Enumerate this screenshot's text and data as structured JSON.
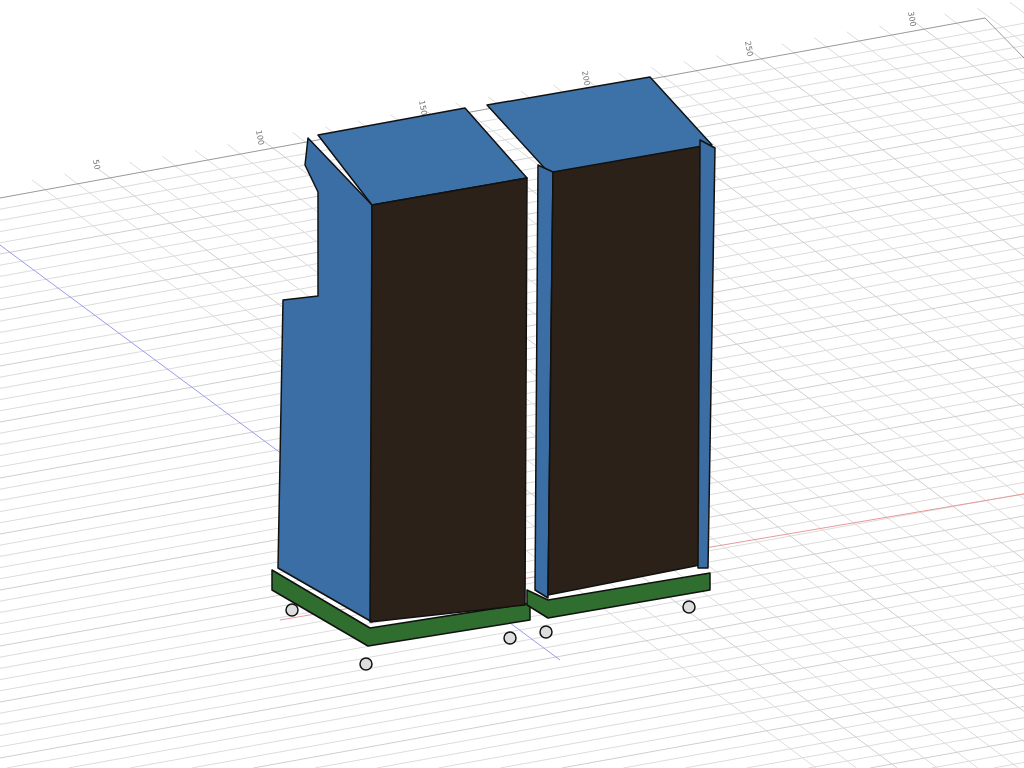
{
  "viewport": {
    "ruler_labels": [
      "50",
      "100",
      "150",
      "200",
      "250",
      "300"
    ]
  }
}
